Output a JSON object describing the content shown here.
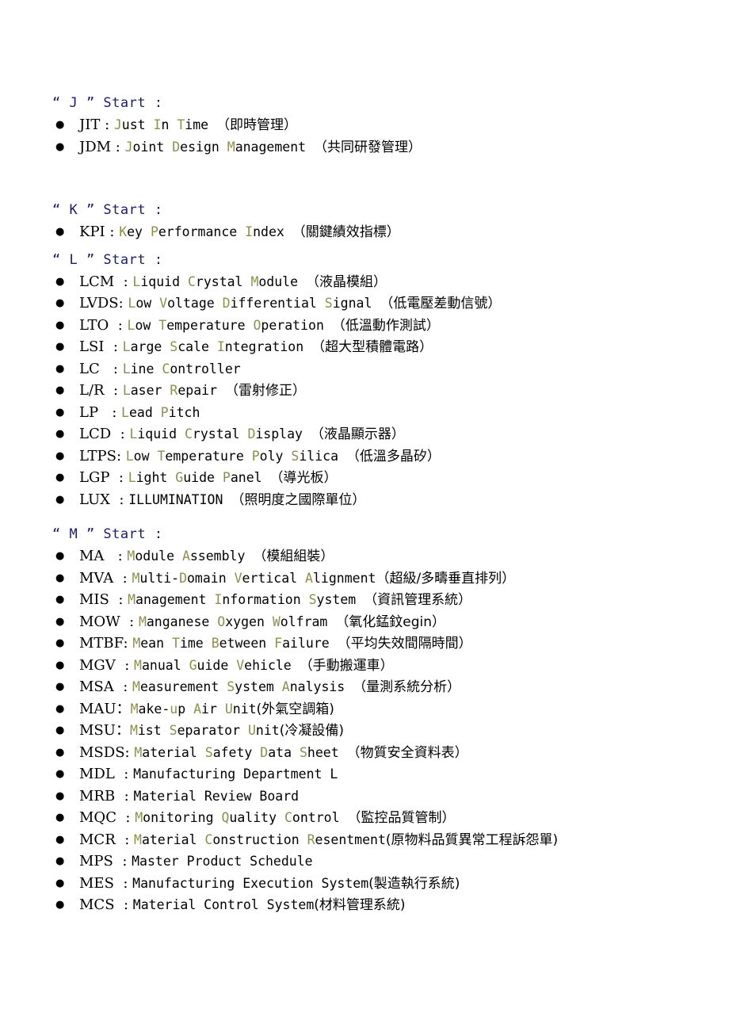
{
  "document": {
    "bullet_glyph": "●",
    "separator": " : ",
    "separator_fullwidth": "：",
    "colors": {
      "header_blue": "#1b1b6e",
      "initial_olive": "#8f8f4d",
      "body_black": "#000000",
      "page_background": "#ffffff"
    }
  },
  "sections": [
    {
      "id": "section-j",
      "header": "“ J ” Start :",
      "letter": "J",
      "entries": [
        {
          "abbr": "JIT",
          "sep": " : ",
          "expansion": "Just In Time",
          "initials": [
            "J",
            "I",
            "T"
          ],
          "gloss": "（即時管理）",
          "gloss_spaced": true,
          "highlight": true
        },
        {
          "abbr": "JDM",
          "sep": " : ",
          "expansion": "Joint Design Management",
          "initials": [
            "J",
            "D",
            "M"
          ],
          "gloss": "（共同研發管理）",
          "gloss_spaced": true,
          "highlight": true
        }
      ]
    },
    {
      "id": "section-k",
      "header": "“ K ” Start :",
      "letter": "K",
      "entries": [
        {
          "abbr": "KPI",
          "sep": " : ",
          "expansion": "Key Performance Index",
          "initials": [
            "K",
            "P",
            "I"
          ],
          "gloss": "（關鍵績效指標）",
          "gloss_spaced": true,
          "highlight": true
        }
      ]
    },
    {
      "id": "section-l",
      "header": "“ L ” Start :",
      "letter": "L",
      "entries": [
        {
          "abbr": "LCM ",
          "sep": " : ",
          "expansion": "Liquid Crystal Module",
          "initials": [
            "L",
            "C",
            "M"
          ],
          "gloss": "（液晶模組）",
          "gloss_spaced": true,
          "highlight": true
        },
        {
          "abbr": "LVDS",
          "sep": ": ",
          "expansion": "Low Voltage Differential Signal",
          "initials": [
            "L",
            "V",
            "D",
            "S"
          ],
          "gloss": "（低電壓差動信號）",
          "gloss_spaced": true,
          "highlight": true
        },
        {
          "abbr": "LTO ",
          "sep": " : ",
          "expansion": "Low Temperature Operation",
          "initials": [
            "L",
            "T",
            "O"
          ],
          "gloss": "（低溫動作測試）",
          "gloss_spaced": true,
          "highlight": true
        },
        {
          "abbr": "LSI ",
          "sep": " : ",
          "expansion": "Large Scale Integration",
          "initials": [
            "L",
            "S",
            "I"
          ],
          "gloss": "（超大型積體電路）",
          "gloss_spaced": true,
          "highlight": true
        },
        {
          "abbr": "LC  ",
          "sep": " : ",
          "expansion": "Line Controller",
          "initials": [
            "L",
            "C"
          ],
          "gloss": "",
          "gloss_spaced": false,
          "highlight": true
        },
        {
          "abbr": "L/R ",
          "sep": " : ",
          "expansion": "Laser Repair",
          "initials": [
            "L",
            "R"
          ],
          "gloss": "（雷射修正）",
          "gloss_spaced": true,
          "highlight": true
        },
        {
          "abbr": "LP  ",
          "sep": " : ",
          "expansion": "Lead Pitch",
          "initials": [
            "L",
            "P"
          ],
          "gloss": "",
          "gloss_spaced": false,
          "highlight": true
        },
        {
          "abbr": "LCD ",
          "sep": " : ",
          "expansion": "Liquid Crystal Display",
          "initials": [
            "L",
            "C",
            "D"
          ],
          "gloss": "（液晶顯示器）",
          "gloss_spaced": true,
          "highlight": true
        },
        {
          "abbr": "LTPS",
          "sep": ": ",
          "expansion": "Low Temperature Poly Silica",
          "initials": [
            "L",
            "T",
            "P",
            "S"
          ],
          "gloss": "（低溫多晶矽）",
          "gloss_spaced": true,
          "highlight": true
        },
        {
          "abbr": "LGP ",
          "sep": " : ",
          "expansion": "Light Guide Panel",
          "initials": [
            "L",
            "G",
            "P"
          ],
          "gloss": "（導光板）",
          "gloss_spaced": true,
          "highlight": true
        },
        {
          "abbr": "LUX ",
          "sep": " : ",
          "expansion": "ILLUMINATION",
          "initials": [],
          "gloss": "（照明度之國際單位）",
          "gloss_spaced": true,
          "highlight": false
        }
      ]
    },
    {
      "id": "section-m",
      "header": "“ M ” Start :",
      "letter": "M",
      "entries": [
        {
          "abbr": "MA  ",
          "sep": " : ",
          "expansion": "Module Assembly",
          "initials": [
            "M",
            "A"
          ],
          "gloss": "（模組組裝）",
          "gloss_spaced": true,
          "highlight": true
        },
        {
          "abbr": "MVA ",
          "sep": " : ",
          "expansion": "Multi-Domain Vertical Alignment",
          "initials": [
            "M",
            "D",
            "V",
            "A"
          ],
          "gloss": "（超級/多疇垂直排列）",
          "gloss_spaced": false,
          "highlight": true
        },
        {
          "abbr": "MIS ",
          "sep": " : ",
          "expansion": "Management Information System",
          "initials": [
            "M",
            "I",
            "S"
          ],
          "gloss": "（資訊管理系統）",
          "gloss_spaced": true,
          "highlight": true
        },
        {
          "abbr": "MOW ",
          "sep": " : ",
          "expansion": "Manganese Oxygen Wolfram",
          "initials": [
            "M",
            "O",
            "W"
          ],
          "gloss": "（氧化錳鈫egin）",
          "gloss_spaced": true,
          "highlight": true
        },
        {
          "abbr": "MTBF",
          "sep": ": ",
          "expansion": "Mean Time Between Failure",
          "initials": [
            "M",
            "T",
            "B",
            "F"
          ],
          "gloss": "（平均失效間隔時間）",
          "gloss_spaced": true,
          "highlight": true
        },
        {
          "abbr": "MGV ",
          "sep": " : ",
          "expansion": "Manual Guide Vehicle",
          "initials": [
            "M",
            "G",
            "V"
          ],
          "gloss": "（手動搬運車）",
          "gloss_spaced": true,
          "highlight": true
        },
        {
          "abbr": "MSA ",
          "sep": " : ",
          "expansion": "Measurement System Analysis",
          "initials": [
            "M",
            "S",
            "A"
          ],
          "gloss": "（量測系統分析）",
          "gloss_spaced": true,
          "highlight": true
        },
        {
          "abbr": "MAU",
          "sep": "：",
          "expansion": "Make-up Air Unit",
          "initials": [
            "M",
            "A",
            "U"
          ],
          "gloss": "(外氣空調箱)",
          "gloss_spaced": false,
          "highlight": true
        },
        {
          "abbr": "MSU",
          "sep": "：",
          "expansion": "Mist Separator Unit",
          "initials": [
            "M",
            "S",
            "U"
          ],
          "gloss": "(冷凝設備)",
          "gloss_spaced": false,
          "highlight": true
        },
        {
          "abbr": "MSDS",
          "sep": ": ",
          "expansion": "Material Safety Data Sheet",
          "initials": [
            "M",
            "S",
            "D",
            "S"
          ],
          "gloss": "（物質安全資料表）",
          "gloss_spaced": true,
          "highlight": true
        },
        {
          "abbr": "MDL ",
          "sep": " : ",
          "expansion": "Manufacturing Department L",
          "initials": [],
          "gloss": "",
          "gloss_spaced": false,
          "highlight": false
        },
        {
          "abbr": "MRB ",
          "sep": " : ",
          "expansion": "Material Review Board",
          "initials": [],
          "gloss": "",
          "gloss_spaced": false,
          "highlight": false
        },
        {
          "abbr": "MQC ",
          "sep": " : ",
          "expansion": "Monitoring Quality Control",
          "initials": [
            "M",
            "Q",
            "C"
          ],
          "gloss": "（監控品質管制）",
          "gloss_spaced": true,
          "highlight": true
        },
        {
          "abbr": "MCR ",
          "sep": " : ",
          "expansion": "Material Construction Resentment",
          "initials": [
            "M",
            "C",
            "R"
          ],
          "gloss": "(原物料品質異常工程訴怨單)",
          "gloss_spaced": false,
          "highlight": true
        },
        {
          "abbr": "MPS ",
          "sep": " : ",
          "expansion": "Master Product Schedule",
          "initials": [],
          "gloss": "",
          "gloss_spaced": false,
          "highlight": false
        },
        {
          "abbr": "MES ",
          "sep": " : ",
          "expansion": "Manufacturing Execution System",
          "initials": [],
          "gloss": "(製造執行系統)",
          "gloss_spaced": false,
          "highlight": false
        },
        {
          "abbr": "MCS ",
          "sep": " : ",
          "expansion": "Material Control System",
          "initials": [],
          "gloss": "(材料管理系統)",
          "gloss_spaced": false,
          "highlight": false
        }
      ]
    }
  ]
}
